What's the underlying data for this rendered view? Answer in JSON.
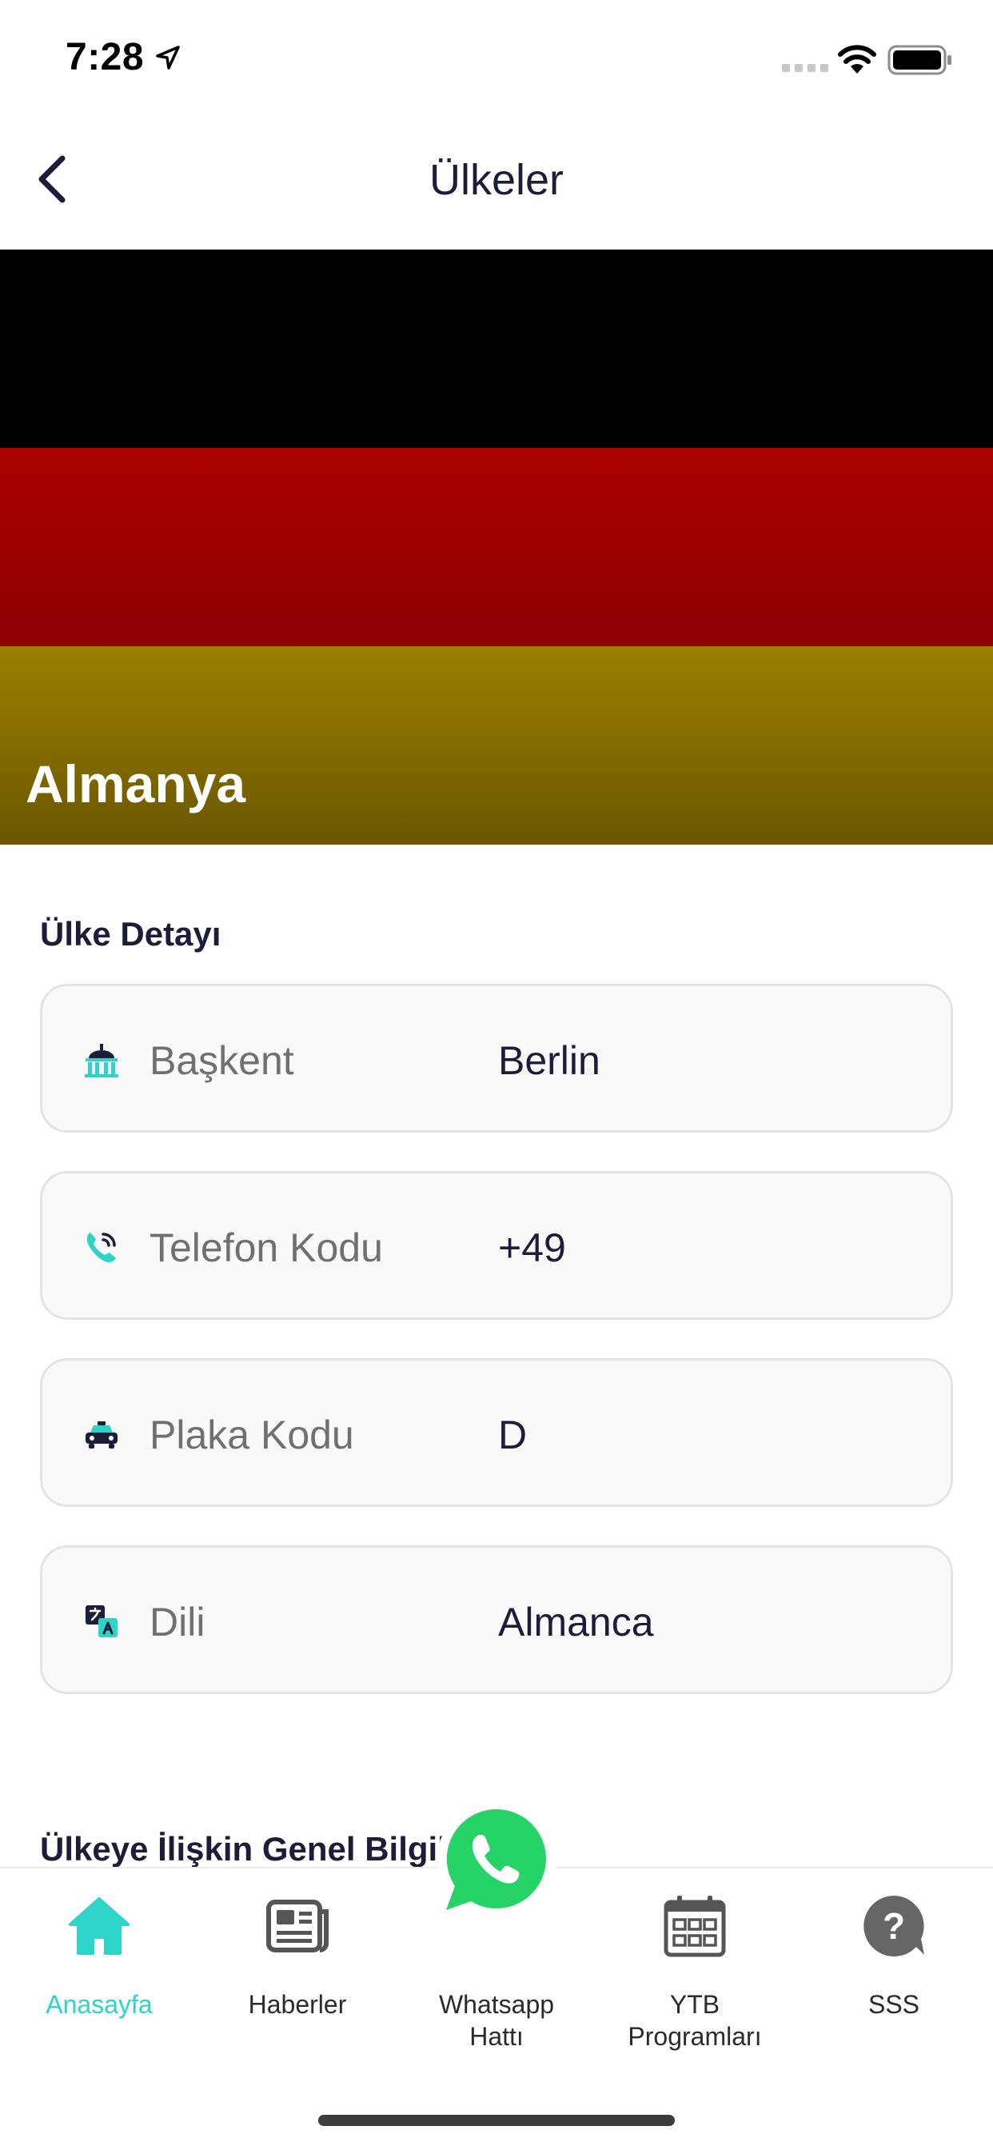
{
  "status_bar": {
    "time": "7:28"
  },
  "nav": {
    "title": "Ülkeler"
  },
  "hero": {
    "country_name": "Almanya",
    "flag_colors": [
      "#000000",
      "#dd0000",
      "#ffce00"
    ]
  },
  "details": {
    "section_title": "Ülke Detayı",
    "items": [
      {
        "icon": "capitol-building-icon",
        "label": "Başkent",
        "value": "Berlin"
      },
      {
        "icon": "phone-call-icon",
        "label": "Telefon Kodu",
        "value": "+49"
      },
      {
        "icon": "car-icon",
        "label": "Plaka Kodu",
        "value": "D"
      },
      {
        "icon": "translate-icon",
        "label": "Dili",
        "value": "Almanca"
      }
    ]
  },
  "general_info": {
    "title": "Ülkeye İlişkin Genel Bilgiler"
  },
  "tab_bar": {
    "tabs": [
      {
        "label": "Anasayfa",
        "icon": "home-icon",
        "active": true
      },
      {
        "label": "Haberler",
        "icon": "newspaper-icon",
        "active": false
      },
      {
        "label": "Whatsapp\nHattı",
        "icon": "whatsapp-icon",
        "active": false
      },
      {
        "label": "YTB\nProgramları",
        "icon": "calendar-icon",
        "active": false
      },
      {
        "label": "SSS",
        "icon": "question-bubble-icon",
        "active": false
      }
    ]
  },
  "colors": {
    "accent": "#2dd4c8",
    "text": "#1c1d3a",
    "whatsapp": "#25d366"
  }
}
